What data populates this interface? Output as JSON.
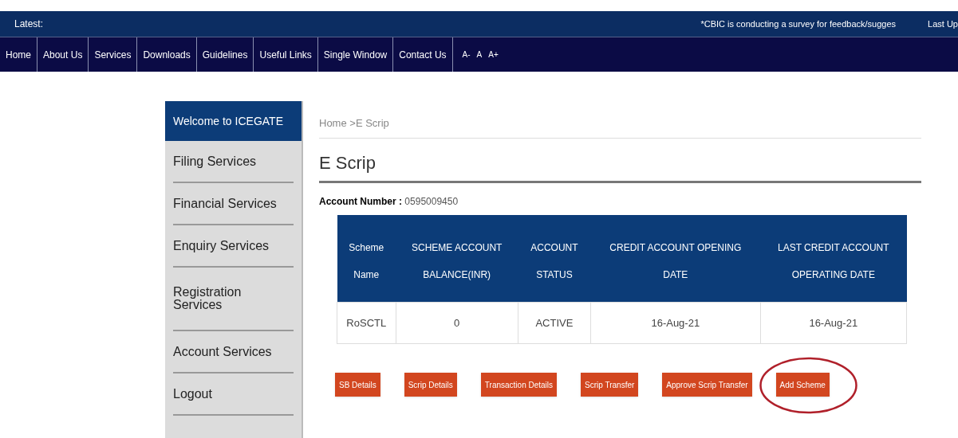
{
  "ticker": {
    "label": "Latest:",
    "message": "*CBIC is conducting a survey for feedback/sugges",
    "updated": "Last Up"
  },
  "nav": {
    "items": [
      "Home",
      "About Us",
      "Services",
      "Downloads",
      "Guidelines",
      "Useful Links",
      "Single Window",
      "Contact Us"
    ],
    "font_sizes": [
      "A-",
      "A",
      "A+"
    ]
  },
  "sidebar": {
    "header": "Welcome to ICEGATE",
    "items": [
      {
        "label": "Filing Services"
      },
      {
        "label": "Financial Services"
      },
      {
        "label": "Enquiry Services"
      },
      {
        "label": "Registration Services"
      },
      {
        "label": "Account Services"
      },
      {
        "label": "Logout"
      }
    ]
  },
  "breadcrumb": "Home >E Scrip",
  "title": "E Scrip",
  "account": {
    "label": "Account Number :",
    "value": "0595009450"
  },
  "table": {
    "header_rows": [
      [
        "Scheme",
        "SCHEME ACCOUNT",
        "ACCOUNT",
        "CREDIT ACCOUNT OPENING",
        "LAST CREDIT ACCOUNT"
      ],
      [
        "Name",
        "BALANCE(INR)",
        "STATUS",
        "DATE",
        "OPERATING DATE"
      ]
    ],
    "rows": [
      [
        "RoSCTL",
        "0",
        "ACTIVE",
        "16-Aug-21",
        "16-Aug-21"
      ]
    ]
  },
  "buttons": [
    {
      "label": "SB Details",
      "circled": false
    },
    {
      "label": "Scrip Details",
      "circled": false
    },
    {
      "label": "Transaction Details",
      "circled": false
    },
    {
      "label": "Scrip Transfer",
      "circled": false
    },
    {
      "label": "Approve Scrip Transfer",
      "circled": false
    },
    {
      "label": "Add Scheme",
      "circled": true
    }
  ]
}
